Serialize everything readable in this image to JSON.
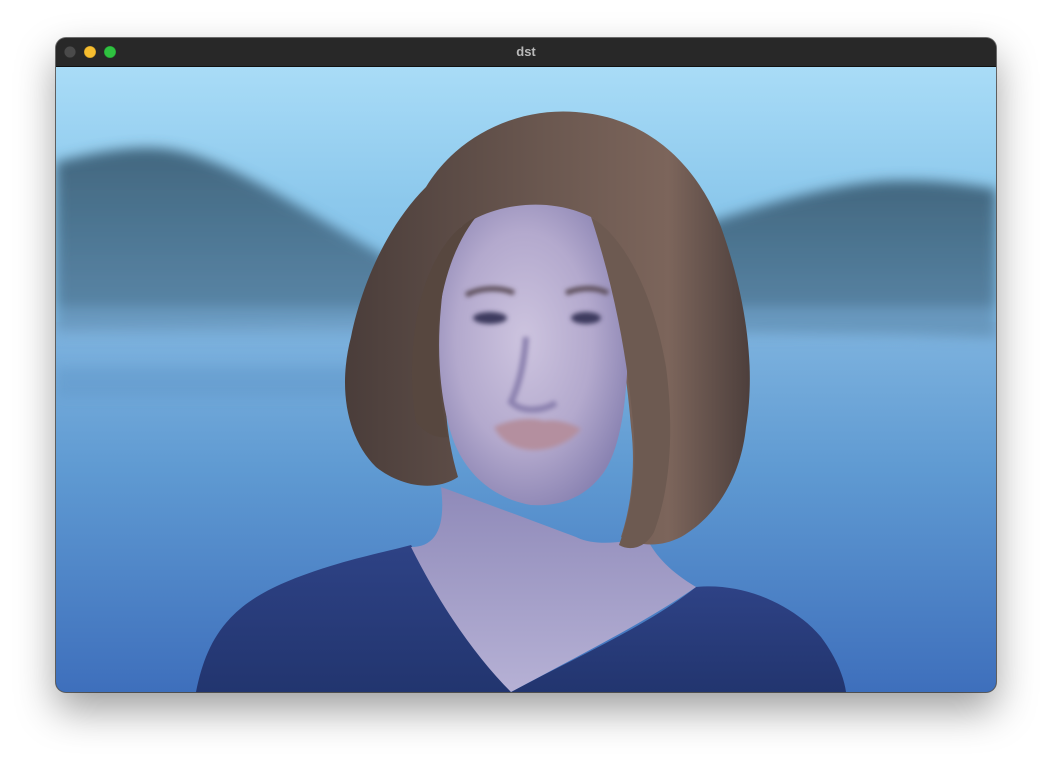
{
  "window": {
    "title": "dst"
  },
  "colors": {
    "titlebar": "#282828",
    "title_text": "#b9b9b9",
    "close_button": "#4a4a4a",
    "minimize_button": "#f6bd2f",
    "maximize_button": "#2fc240",
    "sky": "#a9dcf5",
    "water": "#5d9cd6",
    "shirt": "#2b3f7c",
    "hair": "#5e4e46"
  },
  "image": {
    "subject": "portrait-photo"
  }
}
